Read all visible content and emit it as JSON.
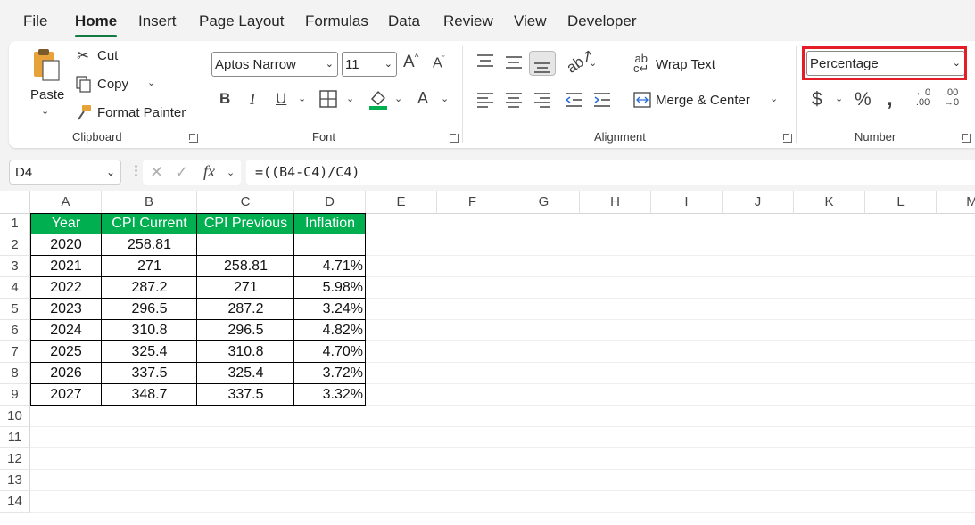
{
  "menu": [
    "File",
    "Home",
    "Insert",
    "Page Layout",
    "Formulas",
    "Data",
    "Review",
    "View",
    "Developer"
  ],
  "active_menu": "Home",
  "clipboard": {
    "paste": "Paste",
    "cut": "Cut",
    "copy": "Copy",
    "format_painter": "Format Painter",
    "group": "Clipboard"
  },
  "font": {
    "name": "Aptos Narrow",
    "size": "11",
    "group": "Font"
  },
  "alignment": {
    "wrap": "Wrap Text",
    "merge": "Merge & Center",
    "group": "Alignment"
  },
  "number": {
    "format": "Percentage",
    "group": "Number"
  },
  "formula_bar": {
    "name_box": "D4",
    "formula": "=((B4-C4)/C4)"
  },
  "columns": [
    "A",
    "B",
    "C",
    "D",
    "E",
    "F",
    "G",
    "H",
    "I",
    "J",
    "K",
    "L",
    "M"
  ],
  "rows": [
    "1",
    "2",
    "3",
    "4",
    "5",
    "6",
    "7",
    "8",
    "9",
    "10",
    "11",
    "12",
    "13",
    "14"
  ],
  "table": {
    "headers": [
      "Year",
      "CPI Current",
      "CPI Previous",
      "Inflation"
    ],
    "rows": [
      [
        "2020",
        "258.81",
        "",
        ""
      ],
      [
        "2021",
        "271",
        "258.81",
        "4.71%"
      ],
      [
        "2022",
        "287.2",
        "271",
        "5.98%"
      ],
      [
        "2023",
        "296.5",
        "287.2",
        "3.24%"
      ],
      [
        "2024",
        "310.8",
        "296.5",
        "4.82%"
      ],
      [
        "2025",
        "325.4",
        "310.8",
        "4.70%"
      ],
      [
        "2026",
        "337.5",
        "325.4",
        "3.72%"
      ],
      [
        "2027",
        "348.7",
        "337.5",
        "3.32%"
      ]
    ]
  },
  "colors": {
    "header_fill": "#00b050",
    "accent": "#107c41",
    "highlight": "#e41e26"
  }
}
